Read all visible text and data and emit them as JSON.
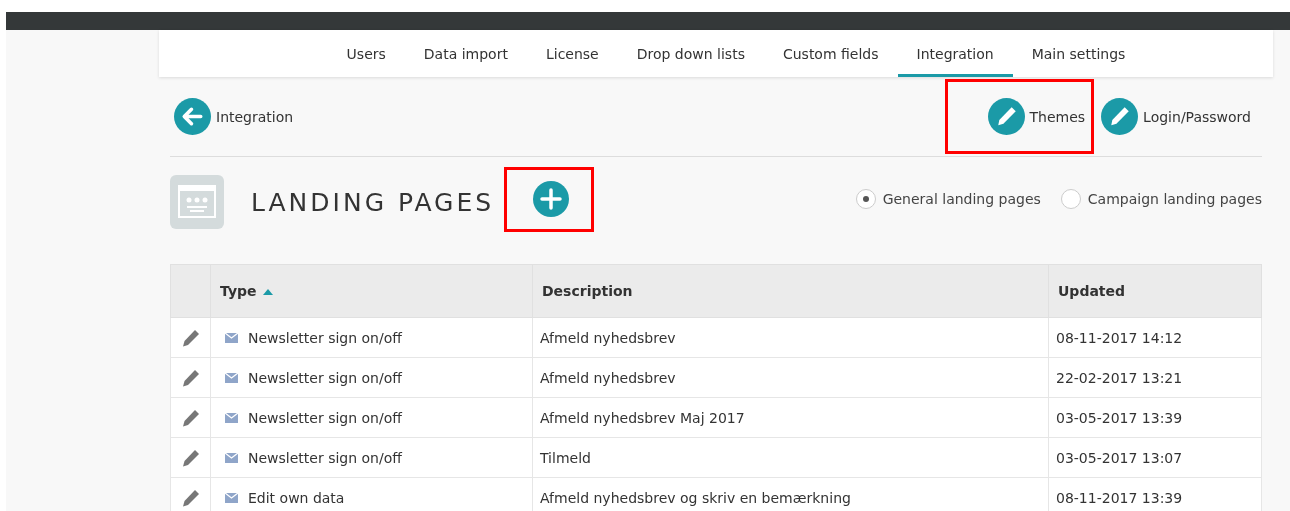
{
  "tabs": [
    {
      "label": "Users",
      "selected": false
    },
    {
      "label": "Data import",
      "selected": false
    },
    {
      "label": "License",
      "selected": false
    },
    {
      "label": "Drop down lists",
      "selected": false
    },
    {
      "label": "Custom fields",
      "selected": false
    },
    {
      "label": "Integration",
      "selected": true
    },
    {
      "label": "Main settings",
      "selected": false
    }
  ],
  "back_link": {
    "label": "Integration"
  },
  "actions": [
    {
      "label": "Themes",
      "highlighted": true
    },
    {
      "label": "Login/Password",
      "highlighted": false
    }
  ],
  "heading": {
    "title": "LANDING PAGES",
    "add_highlighted": true
  },
  "filters": [
    {
      "label": "General landing pages",
      "selected": true
    },
    {
      "label": "Campaign landing pages",
      "selected": false
    }
  ],
  "table": {
    "columns": [
      {
        "label": "Type",
        "sorted": true
      },
      {
        "label": "Description",
        "sorted": false
      },
      {
        "label": "Updated",
        "sorted": false
      }
    ],
    "rows": [
      {
        "type": "Newsletter sign on/off",
        "description": "Afmeld nyhedsbrev",
        "updated": "08-11-2017 14:12"
      },
      {
        "type": "Newsletter sign on/off",
        "description": "Afmeld nyhedsbrev",
        "updated": "22-02-2017 13:21"
      },
      {
        "type": "Newsletter sign on/off",
        "description": "Afmeld nyhedsbrev Maj 2017",
        "updated": "03-05-2017 13:39"
      },
      {
        "type": "Newsletter sign on/off",
        "description": "Tilmeld",
        "updated": "03-05-2017 13:07"
      },
      {
        "type": "Edit own data",
        "description": "Afmeld nyhedsbrev og skriv en bemærkning",
        "updated": "08-11-2017 13:39"
      }
    ]
  }
}
